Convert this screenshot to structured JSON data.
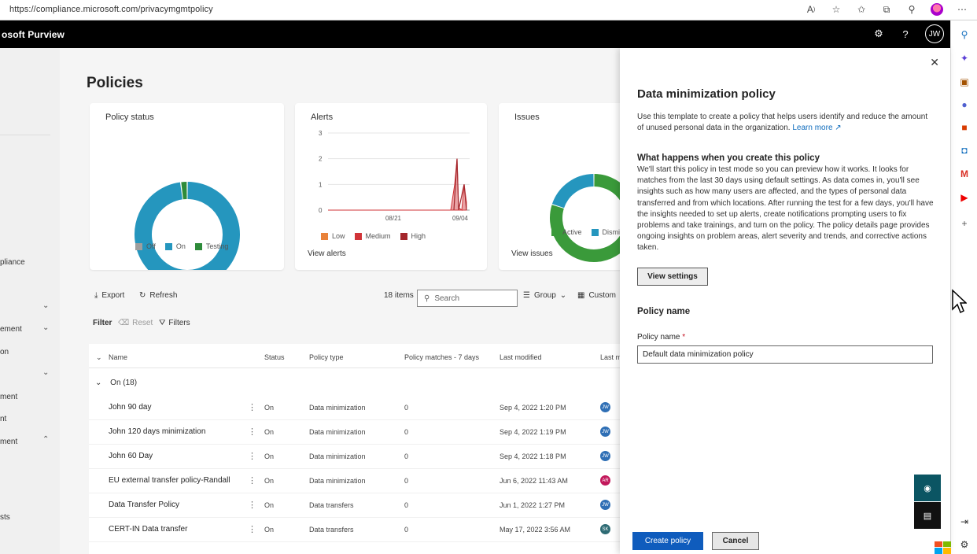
{
  "browser": {
    "url": "https://compliance.microsoft.com/privacymgmtpolicy"
  },
  "header": {
    "app_title": "osoft Purview",
    "user_initials": "JW"
  },
  "leftnav": {
    "items": [
      "pliance",
      "ement",
      "on",
      "ment",
      "nt",
      "ment",
      "sts"
    ]
  },
  "main": {
    "page_title": "Policies",
    "cards": {
      "policy_status": {
        "title": "Policy status",
        "legend": [
          "Off",
          "On",
          "Testing"
        ]
      },
      "alerts": {
        "title": "Alerts",
        "legend": [
          "Low",
          "Medium",
          "High"
        ],
        "link": "View alerts"
      },
      "issues": {
        "title": "Issues",
        "legend": [
          "Active",
          "Dismi"
        ],
        "link": "View issues"
      }
    },
    "toolbar": {
      "export": "Export",
      "refresh": "Refresh",
      "count": "18 items",
      "search_placeholder": "Search",
      "group": "Group",
      "customize": "Custom"
    },
    "filterbar": {
      "filter": "Filter",
      "reset": "Reset",
      "filters": "Filters"
    },
    "table": {
      "headers": {
        "name": "Name",
        "status": "Status",
        "type": "Policy type",
        "matches": "Policy matches - 7 days",
        "modified": "Last modified",
        "lastby": "Last m"
      },
      "group_label": "On (18)",
      "rows": [
        {
          "name": "John 90 day",
          "status": "On",
          "type": "Data minimization",
          "matches": "0",
          "modified": "Sep 4, 2022 1:20 PM",
          "initials": "JW"
        },
        {
          "name": "John 120 days minimization",
          "status": "On",
          "type": "Data minimization",
          "matches": "0",
          "modified": "Sep 4, 2022 1:19 PM",
          "initials": "JW"
        },
        {
          "name": "John 60 Day",
          "status": "On",
          "type": "Data minimization",
          "matches": "0",
          "modified": "Sep 4, 2022 1:18 PM",
          "initials": "JW"
        },
        {
          "name": "EU external transfer policy-Randall",
          "status": "On",
          "type": "Data minimization",
          "matches": "0",
          "modified": "Jun 6, 2022 11:43 AM",
          "initials": "AR"
        },
        {
          "name": "Data Transfer Policy",
          "status": "On",
          "type": "Data transfers",
          "matches": "0",
          "modified": "Jun 1, 2022 1:27 PM",
          "initials": "JW"
        },
        {
          "name": "CERT-IN Data transfer",
          "status": "On",
          "type": "Data transfers",
          "matches": "0",
          "modified": "May 17, 2022 3:56 AM",
          "initials": "SK"
        }
      ]
    }
  },
  "panel": {
    "title": "Data minimization policy",
    "description": "Use this template to create a policy that helps users identify and reduce the amount of unused personal data in the organization.",
    "learn_more": "Learn more",
    "section_title": "What happens when you create this policy",
    "section_body": "We'll start this policy in test mode so you can preview how it works. It looks for matches from the last 30 days using default settings. As data comes in, you'll see insights such as how many users are affected, and the types of personal data transferred and from which locations. After running the test for a few days, you'll have the insights needed to set up alerts, create notifications prompting users to fix problems and take trainings, and turn on the policy. The policy details page provides ongoing insights on problem areas, alert severity and trends, and corrective actions taken.",
    "view_settings": "View settings",
    "policy_name_heading": "Policy name",
    "policy_name_label": "Policy name",
    "required_mark": "*",
    "policy_name_value": "Default data minimization policy",
    "create_button": "Create policy",
    "cancel_button": "Cancel"
  },
  "chart_data": [
    {
      "type": "pie",
      "title": "Policy status",
      "categories": [
        "Off",
        "On",
        "Testing"
      ],
      "values": [
        0,
        98,
        2
      ],
      "colors": [
        "#9e9e9e",
        "#2596be",
        "#2e8b3a"
      ]
    },
    {
      "type": "area",
      "title": "Alerts",
      "x": [
        "08/21",
        "09/04"
      ],
      "ylim": [
        0,
        3
      ],
      "yticks": [
        0,
        1,
        2,
        3
      ],
      "series": [
        {
          "name": "Low",
          "color": "#e9823a"
        },
        {
          "name": "Medium",
          "color": "#d13438"
        },
        {
          "name": "High",
          "color": "#a4262c"
        }
      ]
    },
    {
      "type": "pie",
      "title": "Issues",
      "categories": [
        "Active",
        "Dismi"
      ],
      "values": [
        80,
        20
      ],
      "colors": [
        "#3a9a3a",
        "#2596be"
      ]
    }
  ],
  "colors": {
    "accent": "#0f5cbd",
    "header_bg": "#000000",
    "on_color": "#2596be",
    "testing_color": "#2e8b3a"
  }
}
